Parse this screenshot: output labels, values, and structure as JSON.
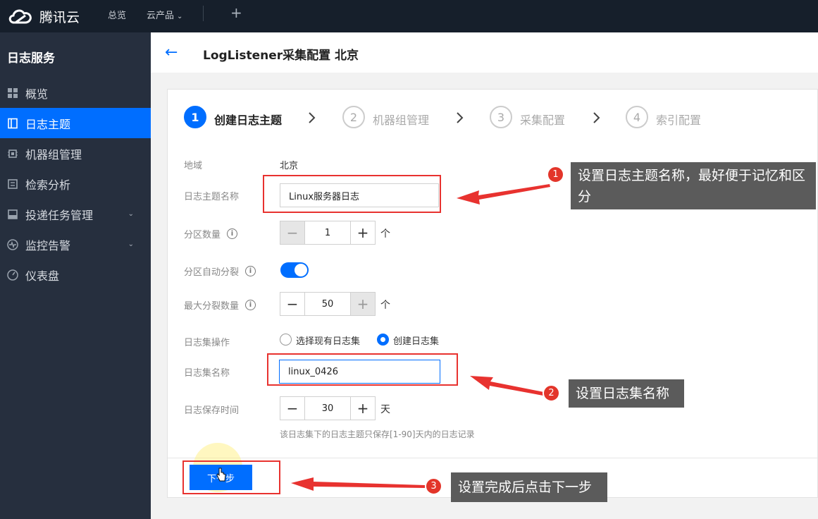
{
  "topbar": {
    "logo_text": "腾讯云",
    "nav_overview": "总览",
    "nav_products": "云产品",
    "plus": "+"
  },
  "sidebar": {
    "title": "日志服务",
    "items": [
      {
        "label": "概览",
        "icon": "grid-icon"
      },
      {
        "label": "日志主题",
        "icon": "document-icon",
        "active": true
      },
      {
        "label": "机器组管理",
        "icon": "chip-icon"
      },
      {
        "label": "检索分析",
        "icon": "list-icon"
      },
      {
        "label": "投递任务管理",
        "icon": "inbox-icon",
        "expandable": true
      },
      {
        "label": "监控告警",
        "icon": "pulse-icon",
        "expandable": true
      },
      {
        "label": "仪表盘",
        "icon": "gauge-icon"
      }
    ]
  },
  "header": {
    "title": "LogListener采集配置 北京"
  },
  "steps": [
    {
      "num": "1",
      "label": "创建日志主题",
      "active": true
    },
    {
      "num": "2",
      "label": "机器组管理"
    },
    {
      "num": "3",
      "label": "采集配置"
    },
    {
      "num": "4",
      "label": "索引配置"
    }
  ],
  "form": {
    "region_label": "地域",
    "region_value": "北京",
    "topic_name_label": "日志主题名称",
    "topic_name_value": "Linux服务器日志",
    "partition_count_label": "分区数量",
    "partition_count_value": "1",
    "partition_unit": "个",
    "auto_split_label": "分区自动分裂",
    "auto_split_on": true,
    "max_split_label": "最大分裂数量",
    "max_split_value": "50",
    "max_split_unit": "个",
    "logset_op_label": "日志集操作",
    "logset_op_option_existing": "选择现有日志集",
    "logset_op_option_create": "创建日志集",
    "logset_op_selected": "创建日志集",
    "logset_name_label": "日志集名称",
    "logset_name_value": "linux_0426",
    "retention_label": "日志保存时间",
    "retention_value": "30",
    "retention_unit": "天",
    "retention_hint": "该日志集下的日志主题只保存[1-90]天内的日志记录",
    "next_button": "下一步",
    "minus": "−",
    "plus": "+",
    "info": "i"
  },
  "annotations": [
    {
      "num": "1",
      "text": "设置日志主题名称，最好便于记忆和区分"
    },
    {
      "num": "2",
      "text": "设置日志集名称"
    },
    {
      "num": "3",
      "text": "设置完成后点击下一步"
    }
  ],
  "colors": {
    "accent": "#006eff",
    "annotation_red": "#e8322f",
    "callout_bg": "#5b5b5b",
    "sidebar_bg": "#262f3e",
    "topbar_bg": "#161f2b"
  }
}
